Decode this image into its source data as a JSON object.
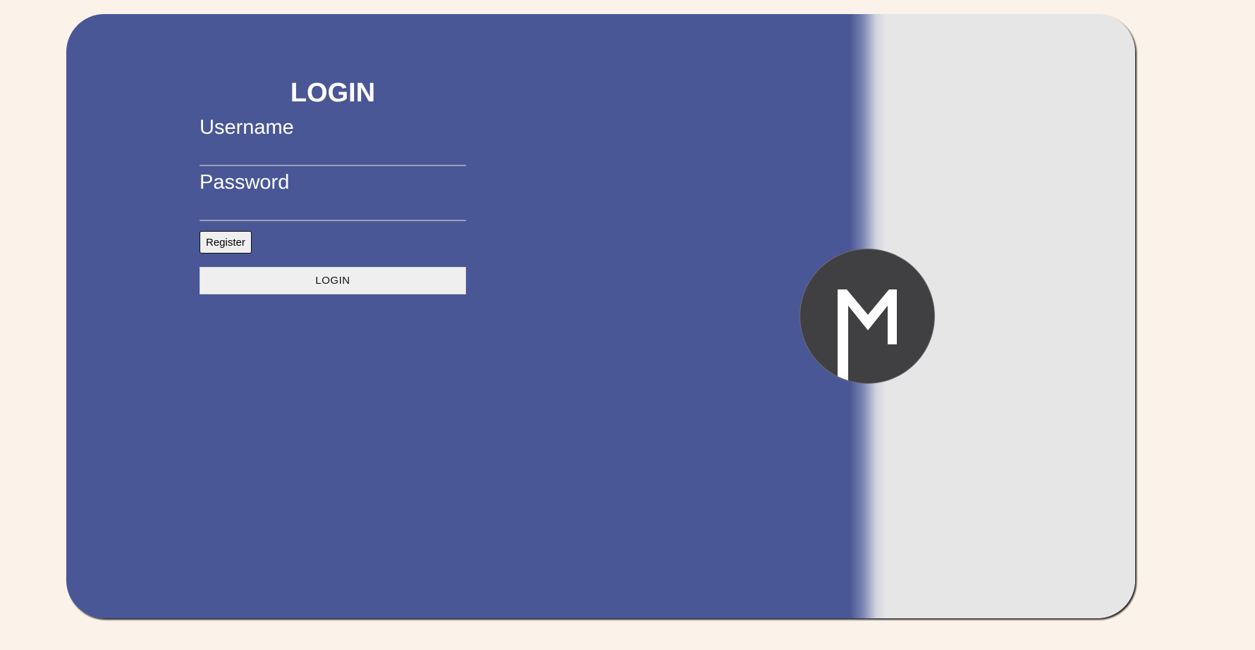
{
  "login": {
    "title": "LOGIN",
    "username_label": "Username",
    "password_label": "Password",
    "register_label": "Register",
    "submit_label": "LOGIN"
  },
  "colors": {
    "page_background": "#fbf3ea",
    "panel_blue": "#495796",
    "panel_gray": "#e6e6e6",
    "logo_circle": "#404042",
    "logo_mark": "#ffffff"
  },
  "logo": {
    "icon": "m-logo-icon"
  }
}
